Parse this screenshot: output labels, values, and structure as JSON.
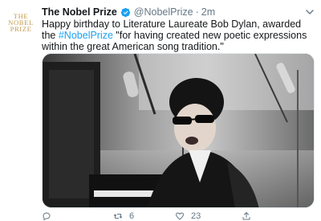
{
  "account": {
    "name": "The Nobel Prize",
    "handle": "@NobelPrize",
    "separator": "·",
    "time": "2m",
    "avatar_lines": [
      "THE",
      "NOBEL",
      "PRIZE"
    ]
  },
  "tweet": {
    "text_before": "Happy birthday to Literature Laureate Bob Dylan, awarded the ",
    "hashtag": "#NobelPrize",
    "text_after": " \"for having created new poetic expressions within the great American song tradition.\""
  },
  "actions": {
    "replies": "",
    "retweets": "6",
    "likes": "23"
  },
  "colors": {
    "link": "#1da1f2",
    "secondary": "#657786",
    "brand_gold": "#c29b4d"
  },
  "icons": [
    "verified-badge-icon",
    "chevron-down-icon",
    "reply-icon",
    "retweet-icon",
    "like-icon",
    "share-icon"
  ]
}
